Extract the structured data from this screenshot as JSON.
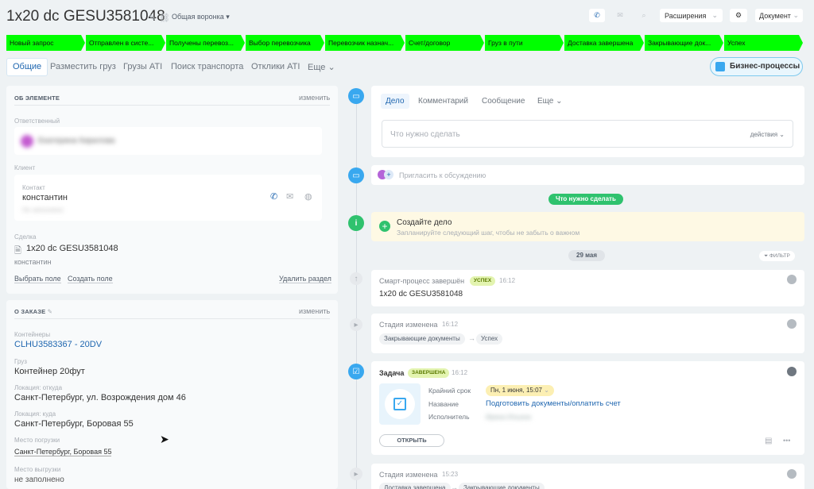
{
  "header": {
    "title": "1x20 dc GESU3581048",
    "funnel": "Общая воронка",
    "extensions": "Расширения",
    "document": "Документ"
  },
  "stages": [
    "Новый запрос",
    "Отправлен в систе...",
    "Получены перевоз...",
    "Выбор перевозчика",
    "Перевозчик назнач...",
    "Счет/договор",
    "Груз в пути",
    "Доставка завершена",
    "Закрывающие док...",
    "Успех"
  ],
  "stage_color": "#00ff00",
  "tabs": [
    "Общие",
    "Разместить груз",
    "Грузы ATI",
    "Поиск транспорта",
    "Отклики ATI",
    "Еще"
  ],
  "business_processes": "Бизнес-процессы",
  "about": {
    "heading": "ОБ ЭЛЕМЕНТЕ",
    "change": "изменить",
    "responsible_label": "Ответственный",
    "responsible_name": "Екатерина Кирилова",
    "client_label": "Клиент",
    "contact_label": "Контакт",
    "contact_name": "константин",
    "contact_sub": "Не заполнено",
    "deal_label": "Сделка",
    "deal_name": "1x20 dc GESU3581048",
    "deal_sub": "константин",
    "select_field": "Выбрать поле",
    "create_field": "Создать поле",
    "delete_section": "Удалить раздел"
  },
  "order": {
    "heading": "О ЗАКАЗЕ",
    "change": "изменить",
    "containers_label": "Контейнеры",
    "containers": "CLHU3583367 - 20DV",
    "cargo_label": "Груз",
    "cargo": "Контейнер 20фут",
    "from_label": "Локация: откуда",
    "from": "Санкт-Петербург, ул. Возрождения дом 46",
    "to_label": "Локация: куда",
    "to": "Санкт-Петербург, Боровая 55",
    "loading_label": "Место погрузки",
    "loading": "Санкт-Петербург, Боровая 55",
    "unloading_label": "Место выгрузки",
    "unloading": "не заполнено"
  },
  "composer": {
    "tabs": [
      "Дело",
      "Комментарий",
      "Сообщение",
      "Еще"
    ],
    "placeholder": "Что нужно сделать",
    "actions": "действия"
  },
  "invite": "Пригласить к обсуждению",
  "todo_pill": "Что нужно сделать",
  "create_task": {
    "title": "Создайте дело",
    "subtitle": "Запланируйте следующий шаг, чтобы не забыть о важном"
  },
  "date_pill": "29 мая",
  "filter": "ФИЛЬТР",
  "events": {
    "process": {
      "title": "Смарт-процесс завершён",
      "badge": "УСПЕХ",
      "time": "16:12",
      "text": "1x20 dc GESU3581048"
    },
    "stage1": {
      "title": "Стадия изменена",
      "time": "16:12",
      "from": "Закрывающие документы",
      "to": "Успех"
    },
    "task": {
      "title": "Задача",
      "badge": "ЗАВЕРШЕНА",
      "time": "16:12",
      "deadline_label": "Крайний срок",
      "deadline": "Пн, 1 июня, 15:07",
      "name_label": "Название",
      "name": "Подготовить документы/оплатить счет",
      "performer_label": "Исполнитель",
      "performer": "Ирина Ильина",
      "open": "ОТКРЫТЬ"
    },
    "stage2": {
      "title": "Стадия изменена",
      "time": "15:23",
      "from": "Доставка завершена",
      "to": "Закрывающие документы"
    }
  }
}
